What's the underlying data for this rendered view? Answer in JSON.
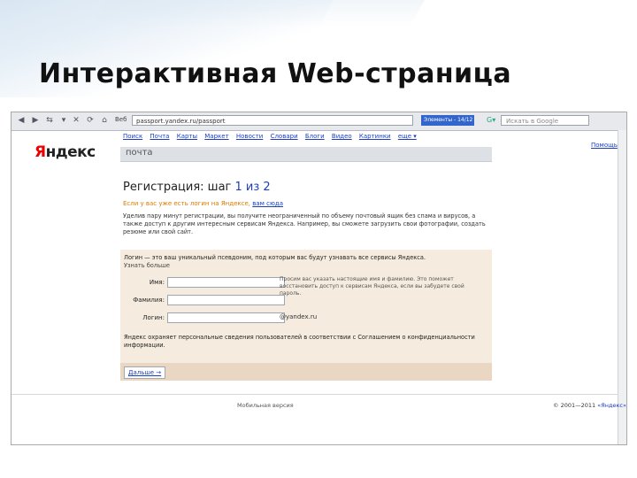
{
  "slide": {
    "title": "Интерактивная Web-страница"
  },
  "browser": {
    "toolbar": {
      "address_label": "Веб",
      "address": "passport.yandex.ru/passport",
      "elements_box": "Элементы - 14/12",
      "search_placeholder": "Искать в Google"
    }
  },
  "page": {
    "nav": [
      "Поиск",
      "Почта",
      "Карты",
      "Маркет",
      "Новости",
      "Словари",
      "Блоги",
      "Видео",
      "Картинки",
      "еще ▾"
    ],
    "help": "Помощь",
    "logo": {
      "first": "Я",
      "rest": "ндекс"
    },
    "service": "почта",
    "title_prefix": "Регистрация: шаг ",
    "title_step": "1 из 2",
    "already_text": "Если у вас уже есть логин на Яндексе, ",
    "already_link": "вам сюда",
    "intro": "Уделив пару минут регистрации, вы получите неограниченный по объему почтовый ящик без спама и вирусов, а также доступ к другим интересным сервисам Яндекса. Например, вы сможете загрузить свои фотографии, создать резюме или свой сайт.",
    "form": {
      "head": "Логин — это ваш уникальный псевдоним, под которым вас будут узнавать все сервисы Яндекса.",
      "more": "Узнать больше",
      "fields": [
        {
          "label": "Имя:",
          "value": ""
        },
        {
          "label": "Фамилия:",
          "value": ""
        },
        {
          "label": "Логин:",
          "value": ""
        }
      ],
      "hint": "Просим вас указать настоящие имя и фамилию. Это поможет восстановить доступ к сервисам Яндекса, если вы забудете свой пароль.",
      "login_suffix": "@yandex.ru",
      "privacy": "Яндекс охраняет персональные сведения пользователей в соответствии с Соглашением о конфиденциальности информации.",
      "next": "Дальше →"
    },
    "footer": {
      "mobile": "Мобильная версия",
      "copyright": "© 2001—2011 ",
      "copyright_link": "«Яндекс»"
    }
  }
}
